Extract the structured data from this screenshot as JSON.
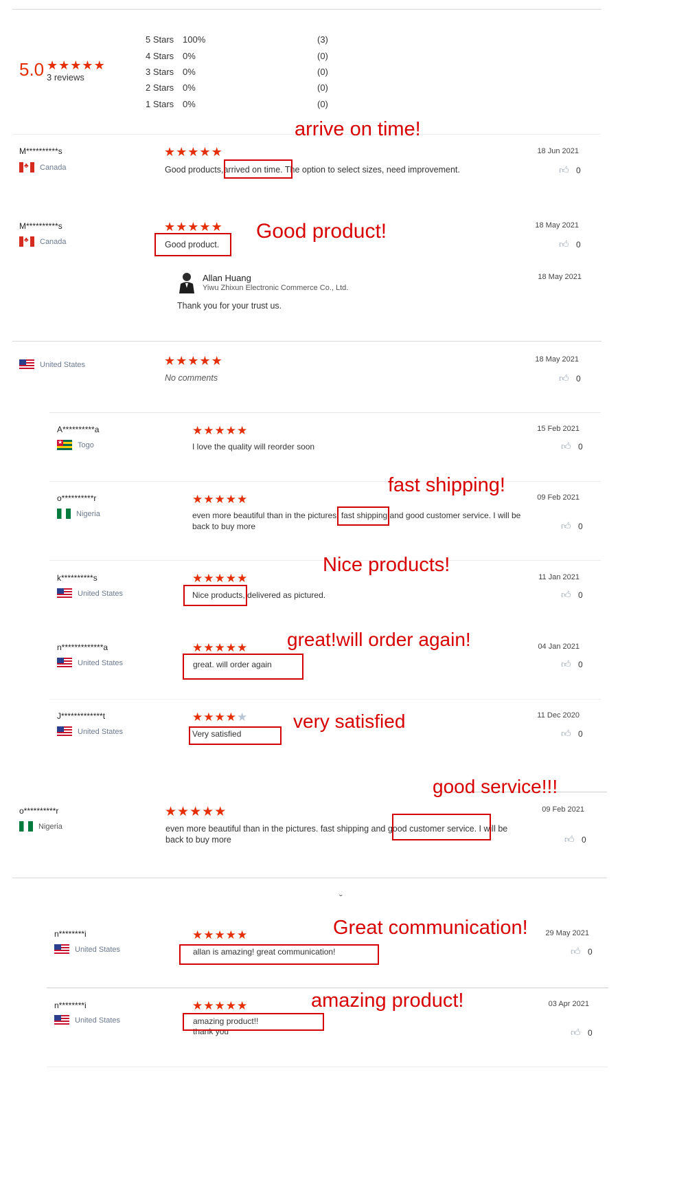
{
  "summary": {
    "average": "5.0",
    "reviews_text": "3 reviews",
    "rows": [
      {
        "label": "5 Stars",
        "percent": "100%",
        "count": "(3)"
      },
      {
        "label": "4 Stars",
        "percent": "0%",
        "count": "(0)"
      },
      {
        "label": "3 Stars",
        "percent": "0%",
        "count": "(0)"
      },
      {
        "label": "2 Stars",
        "percent": "0%",
        "count": "(0)"
      },
      {
        "label": "1 Stars",
        "percent": "0%",
        "count": "(0)"
      }
    ]
  },
  "reviews": [
    {
      "user": "M**********s",
      "country": "Canada",
      "stars": 5,
      "text_before": "Good products,",
      "text_highlight": "arrived on time.",
      "text_after": " The option to select sizes, need improvement.",
      "date": "18 Jun 2021",
      "likes": "0"
    },
    {
      "user": "M**********s",
      "country": "Canada",
      "stars": 5,
      "text_before": "",
      "text_highlight": "Good product.",
      "text_after": "",
      "date": "18 May 2021",
      "likes": "0",
      "reply": {
        "name": "Allan Huang",
        "company": "Yiwu Zhixun Electronic Commerce Co., Ltd.",
        "text": "Thank you for your trust us.",
        "date": "18 May 2021"
      }
    },
    {
      "user": "",
      "country": "United States",
      "stars": 5,
      "text_before": "No comments",
      "text_highlight": "",
      "text_after": "",
      "date": "18 May 2021",
      "likes": "0"
    },
    {
      "user": "A**********a",
      "country": "Togo",
      "stars": 5,
      "text_before": "I love the quality will reorder soon",
      "text_highlight": "",
      "text_after": "",
      "date": "15 Feb 2021",
      "likes": "0"
    },
    {
      "user": "o**********r",
      "country": "Nigeria",
      "stars": 5,
      "text_before": "even more beautiful than in the pictures.",
      "text_highlight": "fast shipping",
      "text_after": " and good customer service. I will be back to buy more",
      "date": "09 Feb 2021",
      "likes": "0"
    },
    {
      "user": "k**********s",
      "country": "United States",
      "stars": 5,
      "text_before": "",
      "text_highlight": "Nice products,",
      "text_after": " delivered as pictured.",
      "date": "11 Jan 2021",
      "likes": "0"
    },
    {
      "user": "n*************a",
      "country": "United States",
      "stars": 5,
      "text_before": "",
      "text_highlight": "great. will order again",
      "text_after": "",
      "date": "04 Jan 2021",
      "likes": "0"
    },
    {
      "user": "J*************t",
      "country": "United States",
      "stars": 4,
      "text_before": "",
      "text_highlight": "Very satisfied",
      "text_after": "",
      "date": "11 Dec 2020",
      "likes": "0"
    },
    {
      "user": "o**********r",
      "country": "Nigeria",
      "stars": 5,
      "text_before": "even more beautiful than in the pictures. fast shipping and ",
      "text_highlight": "good customer service.",
      "text_after": " I will be back to buy more",
      "date": "09 Feb 2021",
      "likes": "0"
    },
    {
      "user": "n********i",
      "country": "United States",
      "stars": 5,
      "text_before": "",
      "text_highlight": "allan is amazing! great communication!",
      "text_after": "",
      "date": "29 May 2021",
      "likes": "0"
    },
    {
      "user": "n********i",
      "country": "United States",
      "stars": 5,
      "text_before": "",
      "text_highlight": "amazing product!!",
      "text_after": "",
      "text_line2": "thank you",
      "date": "03 Apr 2021",
      "likes": "0"
    }
  ],
  "annotations": [
    "arrive on time!",
    "Good product!",
    "fast shipping!",
    "Nice products!",
    "great!will order again!",
    "very satisfied",
    "good service!!!",
    "Great communication!",
    "amazing product!"
  ],
  "colors": {
    "star": "#e62e04",
    "annotation": "#d80000",
    "box": "#d40000"
  },
  "icons": {
    "like": "thumbs-up-icon",
    "star": "star-icon",
    "avatar": "person-icon"
  },
  "divider_mark": "ˬ"
}
